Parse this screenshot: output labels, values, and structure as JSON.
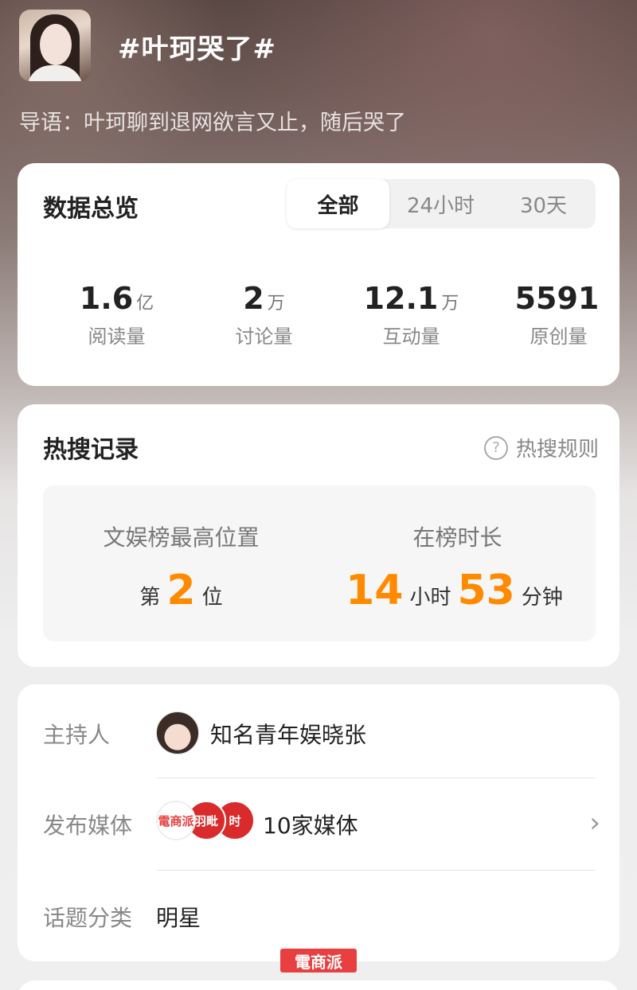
{
  "topic": {
    "title": "#叶珂哭了#",
    "intro": "导语：叶珂聊到退网欲言又止，随后哭了"
  },
  "overview": {
    "title": "数据总览",
    "tabs": [
      {
        "label": "全部",
        "active": true
      },
      {
        "label": "24小时",
        "active": false
      },
      {
        "label": "30天",
        "active": false
      }
    ],
    "stats": [
      {
        "value": "1.6",
        "unit": "亿",
        "label": "阅读量"
      },
      {
        "value": "2",
        "unit": "万",
        "label": "讨论量"
      },
      {
        "value": "12.1",
        "unit": "万",
        "label": "互动量"
      },
      {
        "value": "5591",
        "unit": "",
        "label": "原创量"
      }
    ]
  },
  "hot_search": {
    "title": "热搜记录",
    "rules_label": "热搜规则",
    "peak": {
      "label": "文娱榜最高位置",
      "prefix": "第",
      "value": "2",
      "suffix": "位"
    },
    "duration": {
      "label": "在榜时长",
      "hours": "14",
      "hours_unit": "小时",
      "minutes": "53",
      "minutes_unit": "分钟"
    }
  },
  "info": {
    "host_label": "主持人",
    "host_name": "知名青年娱晓张",
    "media_label": "发布媒体",
    "media_icons": [
      {
        "text": "電商派",
        "color": "#e84040"
      },
      {
        "text": "羽毗",
        "color": "#d92b2b"
      },
      {
        "text": "时",
        "color": "#d92b2b"
      }
    ],
    "media_count": "10家媒体",
    "category_label": "话题分类",
    "category_value": "明星"
  },
  "watermark": "電商派"
}
